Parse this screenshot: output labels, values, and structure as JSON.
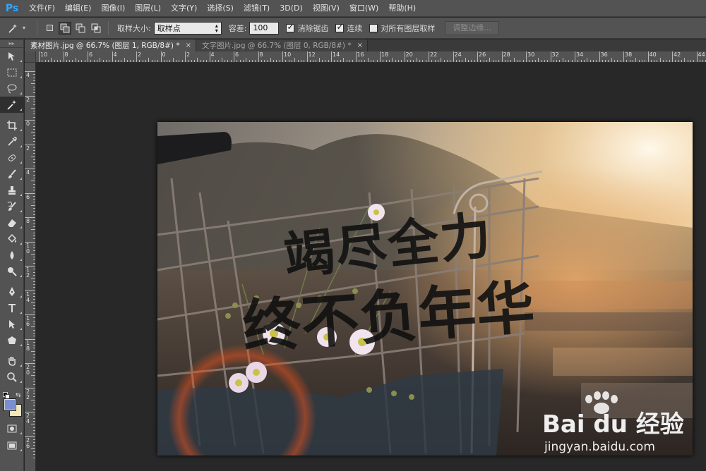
{
  "app": {
    "logo": "Ps"
  },
  "menu": [
    "文件(F)",
    "编辑(E)",
    "图像(I)",
    "图层(L)",
    "文字(Y)",
    "选择(S)",
    "滤镜(T)",
    "3D(D)",
    "视图(V)",
    "窗口(W)",
    "帮助(H)"
  ],
  "options": {
    "sample_size_label": "取样大小:",
    "sample_size_value": "取样点",
    "tolerance_label": "容差:",
    "tolerance_value": "100",
    "antialias_label": "消除锯齿",
    "antialias_checked": true,
    "contiguous_label": "连续",
    "contiguous_checked": true,
    "sample_all_label": "对所有图层取样",
    "sample_all_checked": false,
    "refine_edge_label": "调整边缘..."
  },
  "tabs": [
    {
      "title": "素材图片.jpg @ 66.7% (图层 1, RGB/8#) *",
      "active": true,
      "close": "×"
    },
    {
      "title": "文字图片.jpg @ 66.7% (图层 0, RGB/8#) *",
      "active": false,
      "close": "×"
    }
  ],
  "ruler_top_labels": [
    "10",
    "8",
    "6",
    "4",
    "2",
    "0",
    "2",
    "4",
    "6",
    "8",
    "10",
    "12",
    "14",
    "16",
    "18",
    "20",
    "22",
    "24",
    "26",
    "28",
    "30",
    "32",
    "34",
    "36",
    "38",
    "40",
    "42",
    "44"
  ],
  "ruler_left_labels": [
    "4",
    "2",
    "0",
    "2",
    "4",
    "6",
    "8",
    "10",
    "12",
    "14",
    "16",
    "18",
    "20",
    "22",
    "24",
    "26"
  ],
  "tools": [
    "move-tool-icon",
    "marquee-tool-icon",
    "lasso-tool-icon",
    "magic-wand-tool-icon",
    "crop-tool-icon",
    "eyedropper-tool-icon",
    "healing-brush-tool-icon",
    "brush-tool-icon",
    "clone-stamp-tool-icon",
    "history-brush-tool-icon",
    "eraser-tool-icon",
    "paint-bucket-tool-icon",
    "blur-tool-icon",
    "dodge-tool-icon",
    "pen-tool-icon",
    "type-tool-icon",
    "path-selection-tool-icon",
    "shape-tool-icon",
    "hand-tool-icon",
    "zoom-tool-icon"
  ],
  "colors": {
    "foreground": "#7b8fd0",
    "background": "#f4e9b5",
    "accent": "#31a8ff"
  },
  "image": {
    "calligraphy_line1": "竭尽全力",
    "calligraphy_line2": "终不负年华",
    "watermark_brand": "Bai du 经验",
    "watermark_url": "jingyan.baidu.com"
  }
}
